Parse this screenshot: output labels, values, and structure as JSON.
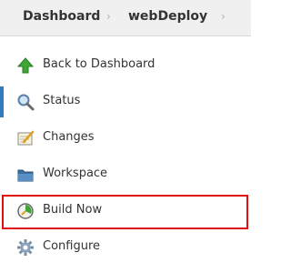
{
  "breadcrumb": {
    "items": [
      {
        "label": "Dashboard"
      },
      {
        "label": "webDeploy"
      }
    ],
    "separator": "›"
  },
  "tasks": [
    {
      "label": "Back to Dashboard",
      "icon": "up-arrow-icon"
    },
    {
      "label": "Status",
      "icon": "magnifier-icon",
      "active": true
    },
    {
      "label": "Changes",
      "icon": "notepad-icon"
    },
    {
      "label": "Workspace",
      "icon": "folder-icon"
    },
    {
      "label": "Build Now",
      "icon": "clock-build-icon",
      "highlighted": true
    },
    {
      "label": "Configure",
      "icon": "gear-icon"
    }
  ],
  "colors": {
    "breadcrumb_bg": "#f0f0f0",
    "active_indicator": "#2f7bbf",
    "highlight_border": "#e01010"
  }
}
